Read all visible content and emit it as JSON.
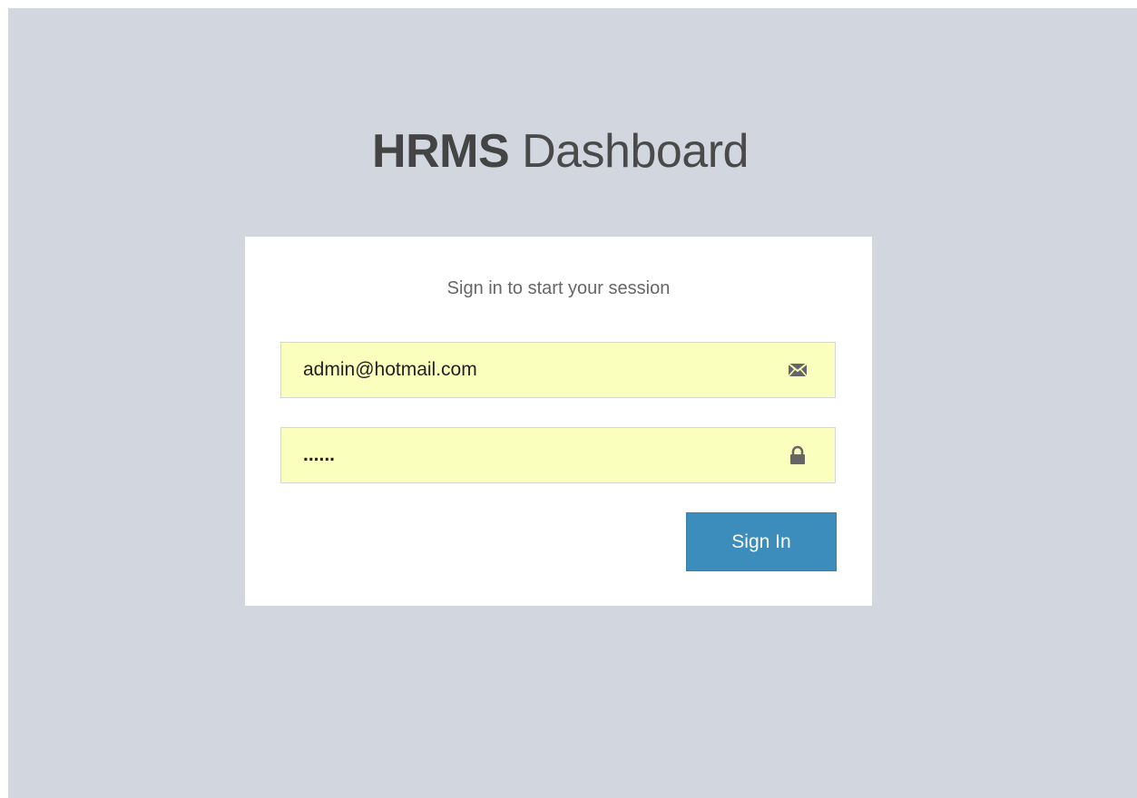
{
  "header": {
    "brand_bold": "HRMS",
    "brand_light": "Dashboard"
  },
  "login": {
    "message": "Sign in to start your session",
    "email": {
      "value": "admin@hotmail.com",
      "icon": "envelope-icon"
    },
    "password": {
      "value": "......",
      "icon": "lock-icon"
    },
    "submit_label": "Sign In"
  },
  "colors": {
    "background": "#d2d6de",
    "autofill": "#faffbd",
    "primary": "#3c8dbc"
  }
}
